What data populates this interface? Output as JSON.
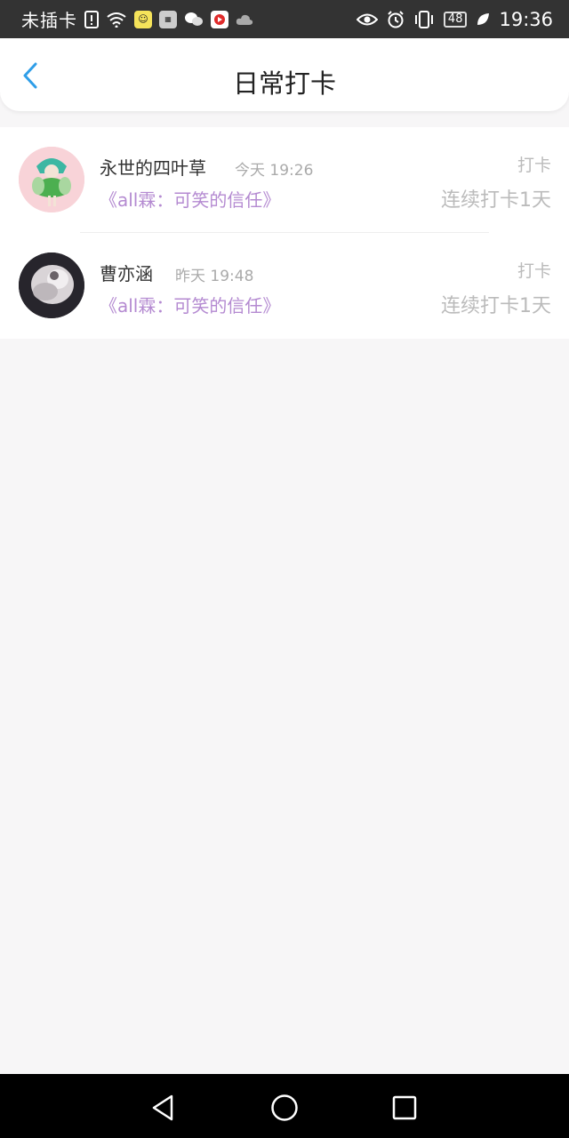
{
  "status_bar": {
    "carrier": "未插卡",
    "battery": "48",
    "time": "19:36",
    "icons": [
      "sim-alert-icon",
      "wifi-icon",
      "app-notification-icon",
      "huawei-app-icon",
      "wechat-icon",
      "video-app-icon",
      "cloud-icon",
      "eye-icon",
      "alarm-icon",
      "vibrate-icon",
      "battery-icon",
      "leaf-icon"
    ]
  },
  "header": {
    "title": "日常打卡",
    "back_icon": "chevron-left-icon",
    "accent_color": "#2f9ee8"
  },
  "checkins": [
    {
      "name": "永世的四叶草",
      "time": "今天 19:26",
      "book": "《all霖：可笑的信任》",
      "action": "打卡",
      "streak": "连续打卡1天"
    },
    {
      "name": "曹亦涵",
      "time": "昨天 19:48",
      "book": "《all霖：可笑的信任》",
      "action": "打卡",
      "streak": "连续打卡1天"
    }
  ],
  "colors": {
    "book_title": "#b48ad1",
    "muted": "#bbbbbb",
    "background": "#f7f6f7"
  },
  "nav_bar": {
    "icons": [
      "back-triangle-icon",
      "home-circle-icon",
      "recents-square-icon"
    ]
  }
}
